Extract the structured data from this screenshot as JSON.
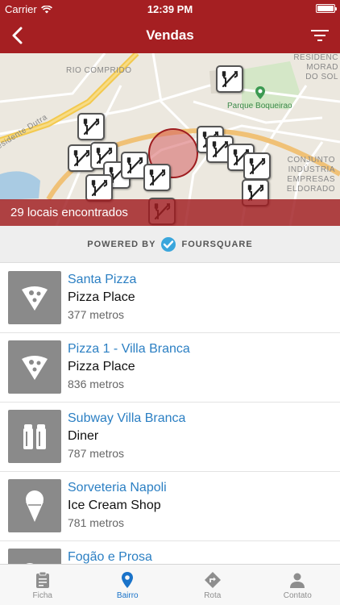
{
  "status_bar": {
    "carrier": "Carrier",
    "time": "12:39 PM"
  },
  "nav": {
    "title": "Vendas",
    "back_icon": "chevron-left-icon",
    "filter_icon": "filter-icon"
  },
  "map": {
    "labels": {
      "rio_comprido": "RIO COMPRIDO",
      "residence_1": "RESIDENC",
      "residence_2": "MORAD",
      "residence_3": "DO SOL",
      "conjunto_1": "CONJUNTO",
      "conjunto_2": "INDÚSTRIA",
      "conjunto_3": "EMPRESAS",
      "conjunto_4": "ELDORADO",
      "dutra": "esidente Dutra",
      "park": "Parque Boqueirao"
    },
    "pin_icon": "fork-knife-icon",
    "results": "29 locais encontrados"
  },
  "powered": {
    "prefix": "POWERED BY",
    "brand": "FOURSQUARE"
  },
  "places": [
    {
      "name": "Santa Pizza",
      "category": "Pizza Place",
      "distance": "377 metros",
      "icon": "pizza-icon"
    },
    {
      "name": "Pizza 1 - Villa Branca",
      "category": "Pizza Place",
      "distance": "836 metros",
      "icon": "pizza-icon"
    },
    {
      "name": "Subway Villa Branca",
      "category": "Diner",
      "distance": "787 metros",
      "icon": "salt-shaker-icon"
    },
    {
      "name": "Sorveteria Napoli",
      "category": "Ice Cream Shop",
      "distance": "781 metros",
      "icon": "ice-cream-icon"
    },
    {
      "name": "Fogão e Prosa",
      "category": "",
      "distance": "",
      "icon": "restaurant-icon"
    }
  ],
  "tabs": [
    {
      "label": "Ficha",
      "icon": "clipboard-icon"
    },
    {
      "label": "Bairro",
      "icon": "location-pin-icon",
      "active": true
    },
    {
      "label": "Rota",
      "icon": "route-sign-icon"
    },
    {
      "label": "Contato",
      "icon": "person-icon"
    }
  ],
  "colors": {
    "brand": "#a51f22",
    "link": "#2b7fc3",
    "tab_active": "#1a73c9"
  }
}
